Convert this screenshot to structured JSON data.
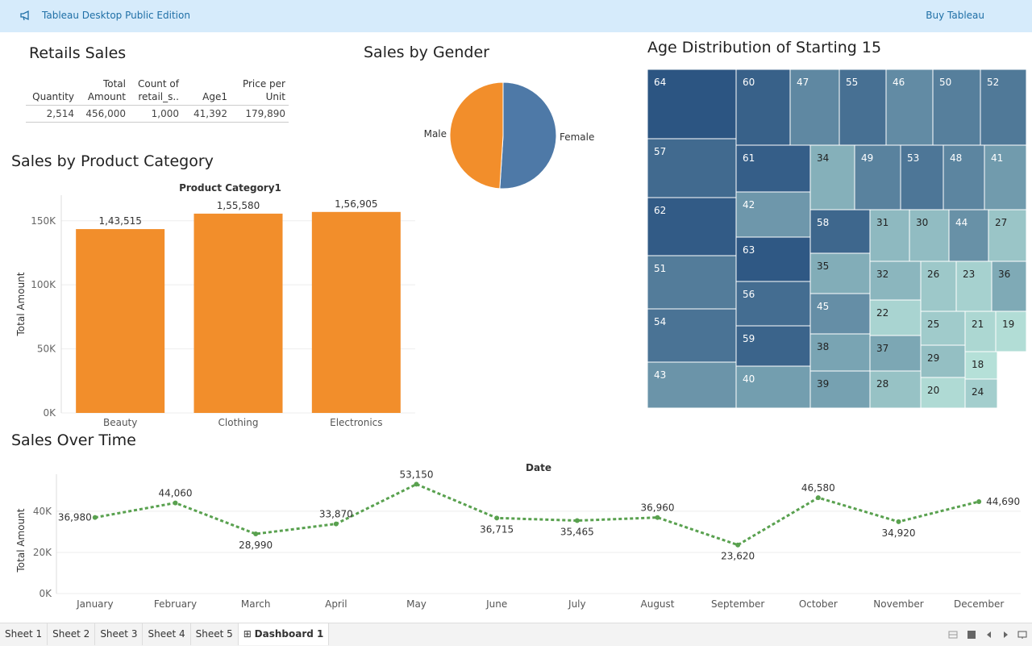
{
  "banner": {
    "title": "Tableau Desktop Public Edition",
    "buy_label": "Buy Tableau"
  },
  "retail": {
    "title": "Retails Sales",
    "headers": [
      "Quantity",
      "Total Amount",
      "Count of retail_s..",
      "Age1",
      "Price per Unit"
    ],
    "values": [
      "2,514",
      "456,000",
      "1,000",
      "41,392",
      "179,890"
    ]
  },
  "gender": {
    "title": "Sales by Gender",
    "chart_data": {
      "type": "pie",
      "slices": [
        {
          "label": "Female",
          "value": 51,
          "color": "#4e79a7"
        },
        {
          "label": "Male",
          "value": 49,
          "color": "#f28e2b"
        }
      ]
    }
  },
  "category": {
    "title": "Sales by Product Category",
    "chart_data": {
      "type": "bar",
      "header": "Product Category1",
      "ylabel": "Total Amount",
      "categories": [
        "Beauty",
        "Clothing",
        "Electronics"
      ],
      "values": [
        143515,
        155580,
        156905
      ],
      "value_labels": [
        "1,43,515",
        "1,55,580",
        "1,56,905"
      ],
      "yticks": [
        "0K",
        "50K",
        "100K",
        "150K"
      ],
      "ylim": [
        0,
        170000
      ],
      "color": "#f28e2b"
    }
  },
  "age": {
    "title": "Age Distribution of Starting 15",
    "chart_data": {
      "type": "heatmap",
      "cells": [
        64,
        57,
        62,
        51,
        54,
        43,
        60,
        47,
        55,
        46,
        50,
        52,
        61,
        34,
        49,
        53,
        48,
        41,
        42,
        58,
        31,
        30,
        44,
        27,
        63,
        35,
        32,
        26,
        23,
        36,
        56,
        45,
        22,
        25,
        21,
        19,
        59,
        38,
        37,
        29,
        18,
        40,
        39,
        28,
        20,
        24
      ]
    }
  },
  "time": {
    "title": "Sales Over Time",
    "chart_data": {
      "type": "line",
      "header": "Date",
      "ylabel": "Total Amount",
      "x": [
        "January",
        "February",
        "March",
        "April",
        "May",
        "June",
        "July",
        "August",
        "September",
        "October",
        "November",
        "December"
      ],
      "values": [
        36980,
        44060,
        28990,
        33870,
        53150,
        36715,
        35465,
        36960,
        23620,
        46580,
        34920,
        44690
      ],
      "value_labels": [
        "36,980",
        "44,060",
        "28,990",
        "33,870",
        "53,150",
        "36,715",
        "35,465",
        "36,960",
        "23,620",
        "46,580",
        "34,920",
        "44,690"
      ],
      "yticks": [
        "0K",
        "20K",
        "40K"
      ],
      "ylim": [
        0,
        58000
      ],
      "color": "#59a14f"
    }
  },
  "tabs": [
    "Sheet 1",
    "Sheet 2",
    "Sheet 3",
    "Sheet 4",
    "Sheet 5",
    "Dashboard 1"
  ],
  "active_tab": "Dashboard 1"
}
